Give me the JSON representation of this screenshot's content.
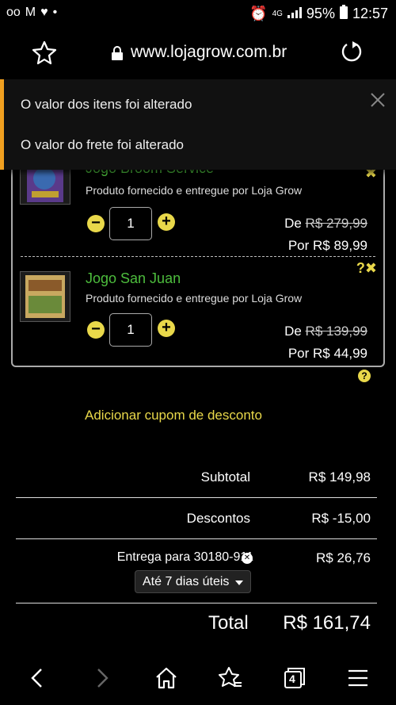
{
  "status_bar": {
    "left_icons": [
      "oo",
      "M",
      "♥",
      "•"
    ],
    "network": "4G",
    "battery": "95%",
    "time": "12:57"
  },
  "browser": {
    "url": "www.lojagrow.com.br"
  },
  "notifications": {
    "message1": "O valor dos itens foi alterado",
    "message2": "O valor do frete foi alterado"
  },
  "cart": {
    "items": [
      {
        "name": "Jogo Broom Service",
        "vendor": "Produto fornecido e entregue por Loja Grow",
        "quantity": "1",
        "price_de_label": "De",
        "price_de": "R$ 279,99",
        "price_por": "Por R$ 89,99"
      },
      {
        "name": "Jogo San Juan",
        "vendor": "Produto fornecido e entregue por Loja Grow",
        "quantity": "1",
        "price_de_label": "De",
        "price_de": "R$ 139,99",
        "price_por": "Por R$ 44,99"
      }
    ]
  },
  "coupon": {
    "label": "Adicionar cupom de desconto"
  },
  "summary": {
    "subtotal_label": "Subtotal",
    "subtotal_value": "R$ 149,98",
    "discount_label": "Descontos",
    "discount_value": "R$ -15,00",
    "shipping_label": "Entrega para 30180-911",
    "shipping_value": "R$ 26,76",
    "shipping_option": "Até 7 dias úteis",
    "total_label": "Total",
    "total_value": "R$ 161,74"
  },
  "bottom_nav": {
    "tab_count": "4"
  },
  "colors": {
    "accent": "#e9d84a",
    "product_name": "#4dbd3d",
    "warning_bar": "#f0a020"
  }
}
